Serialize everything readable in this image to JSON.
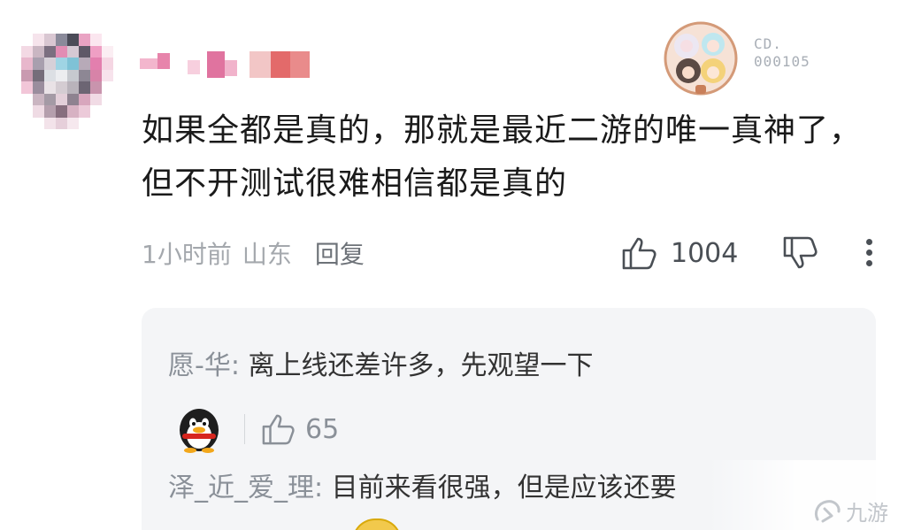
{
  "comment": {
    "text": "如果全都是真的，那就是最近二游的唯一真神了，但不开测试很难相信都是真的",
    "time": "1小时前",
    "location": "山东",
    "reply_label": "回复",
    "like_count": "1004",
    "badge_code_line1": "CD.",
    "badge_code_line2": "000105"
  },
  "replies": [
    {
      "name": "愿-华: ",
      "text": "离上线还差许多，先观望一下",
      "likes": "65"
    },
    {
      "name": "泽_近_爱_理: ",
      "text": "目前来看很强，但是应该还要"
    }
  ],
  "watermark": "九游",
  "colors": {
    "text": "#1a1a1a",
    "meta": "#a4a8ad",
    "reply_bg": "#f4f5f7",
    "reply_name": "#8a9098"
  }
}
